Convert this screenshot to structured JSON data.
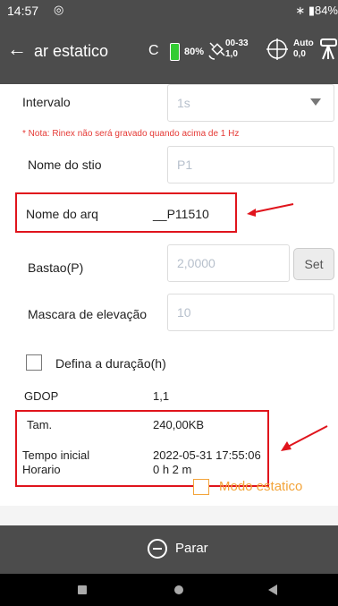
{
  "status_bar": {
    "time": "14:57",
    "notification_icon": "circle-notification-icon",
    "right_text": "∗ ▮84%"
  },
  "header": {
    "back_icon": "arrow-left-icon",
    "title": "ar estatico",
    "fix_label": "C",
    "battery_percent": "80%",
    "satellites_line1": "00-33",
    "satellites_line2": "1,0",
    "mode_line1": "Auto",
    "mode_line2": "0,0"
  },
  "form": {
    "interval": {
      "label": "Intervalo",
      "value": "1s"
    },
    "note": "* Nota: Rinex não será gravado quando acima de 1 Hz",
    "site_name": {
      "label": "Nome do stio",
      "placeholder": "P1"
    },
    "file_name": {
      "label": "Nome do arq",
      "value": "__P11510"
    },
    "pole_height": {
      "label": "Bastao(P)",
      "placeholder": "2,0000",
      "set_button": "Set"
    },
    "elevation_mask": {
      "label": "Mascara de elevação",
      "placeholder": "10"
    },
    "duration_checkbox": {
      "label": "Defina a duração(h)",
      "checked": false
    }
  },
  "info": {
    "gdop": {
      "label": "GDOP",
      "value": "1,1"
    },
    "size": {
      "label": "Tam.",
      "value": "240,00KB"
    },
    "start_time": {
      "label": "Tempo inicial",
      "value": "2022-05-31 17:55:06"
    },
    "schedule": {
      "label": "Horario",
      "value": "0 h 2 m"
    },
    "static_mode": {
      "label": "Modo estatico",
      "checked": false
    }
  },
  "footer": {
    "stop_button": "Parar"
  },
  "colors": {
    "accent": "#e0141c",
    "header_bg": "#4c4c4c",
    "static_mode": "#f3a43a",
    "battery": "#33cc33"
  }
}
